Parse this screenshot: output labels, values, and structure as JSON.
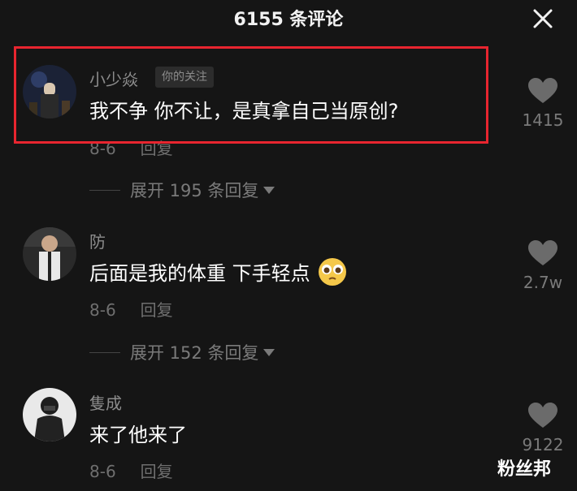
{
  "header": {
    "title": "6155 条评论"
  },
  "comments": [
    {
      "username": "小少焱",
      "badge": "你的关注",
      "text": "我不争 你不让，是真拿自己当原创?",
      "date": "8-6",
      "reply_label": "回复",
      "likes": "1415",
      "expand_label": "展开 195 条回复"
    },
    {
      "username": "防",
      "text": "后面是我的体重 下手轻点",
      "emoji": "🥺",
      "date": "8-6",
      "reply_label": "回复",
      "likes": "2.7w",
      "expand_label": "展开 152 条回复"
    },
    {
      "username": "隻成",
      "text": "来了他来了",
      "date": "8-6",
      "reply_label": "回复",
      "likes": "9122"
    }
  ],
  "watermark": "粉丝邦",
  "colors": {
    "highlight": "#e8252f",
    "background": "#151515"
  },
  "icons": [
    "close-icon",
    "heart-icon",
    "caret-down-icon"
  ]
}
